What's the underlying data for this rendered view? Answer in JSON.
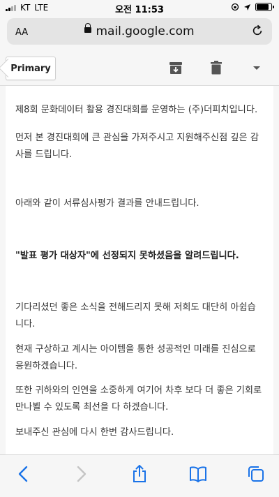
{
  "status_bar": {
    "carrier": "KT",
    "network": "LTE",
    "time": "오전 11:53",
    "battery_level": 0.75
  },
  "address_bar": {
    "text_size_label": "AA",
    "url": "mail.google.com",
    "icons": [
      "lock-icon",
      "reload-icon"
    ]
  },
  "toolbar": {
    "back_label": "Primary",
    "icons": [
      "archive-icon",
      "trash-icon",
      "dropdown-arrow-icon"
    ]
  },
  "email": {
    "paragraphs": [
      "제8회 문화데이터 활용 경진대회를 운영하는 (주)더피치입니다.",
      "먼저 본 경진대회에 큰 관심을 가져주시고 지원해주신점 깊은 감사를 드립니다.",
      "아래와 같이 서류심사평가 결과를 안내드립니다.",
      "\"발표 평가 대상자\"에 선정되지 못하셨음을 알려드립니다.",
      "기다리셨던 좋은 소식을 전해드리지 못해 저희도 대단히 아쉽습니다.",
      "현재 구상하고 계시는 아이템을 통한 성공적인 미래를 진심으로 응원하겠습니다.",
      "또한 귀하와의 인연을 소중하게 여기어 차후 보다 더 좋은 기회로 만나뵐 수 있도록 최선을 다 하겠습니다.",
      "보내주신 관심에 다시 한번 감사드립니다."
    ]
  },
  "bottom_bar": {
    "icons": [
      "back-arrow-icon",
      "forward-arrow-icon",
      "share-icon",
      "bookmarks-icon",
      "tabs-icon"
    ]
  }
}
